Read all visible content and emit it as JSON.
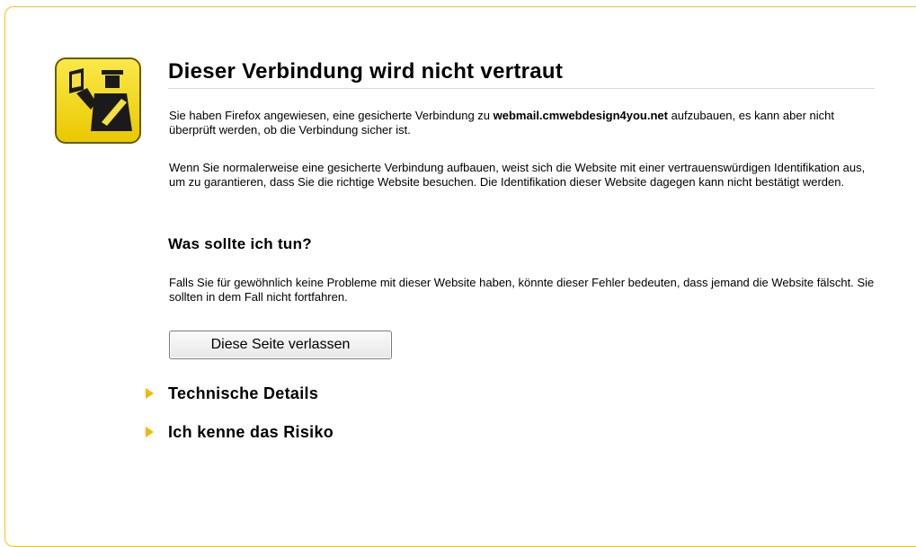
{
  "error_page": {
    "title": "Dieser Verbindung wird nicht vertraut",
    "intro_before_host": "Sie haben Firefox angewiesen, eine gesicherte Verbindung zu ",
    "host": "webmail.cmwebdesign4you.net",
    "intro_after_host": " aufzubauen, es kann aber nicht überprüft werden, ob die Verbindung sicher ist.",
    "explanation": "Wenn Sie normalerweise eine gesicherte Verbindung aufbauen, weist sich die Website mit einer vertrauenswürdigen Identifikation aus, um zu garantieren, dass Sie die richtige Website besuchen. Die Identifikation dieser Website dagegen kann nicht bestätigt werden.",
    "what_to_do_heading": "Was sollte ich tun?",
    "what_to_do_text": "Falls Sie für gewöhnlich keine Probleme mit dieser Website haben, könnte dieser Fehler bedeuten, dass jemand die Website fälscht. Sie sollten in dem Fall nicht fortfahren.",
    "leave_button_label": "Diese Seite verlassen",
    "expanders": [
      {
        "label": "Technische Details",
        "icon": "triangle-right-icon"
      },
      {
        "label": "Ich kenne das Risiko",
        "icon": "triangle-right-icon"
      }
    ],
    "icon": "security-officer-icon"
  },
  "colors": {
    "card_border": "#f0c419",
    "icon_yellow": "#f5d90a",
    "expander_triangle": "#f3b800"
  }
}
